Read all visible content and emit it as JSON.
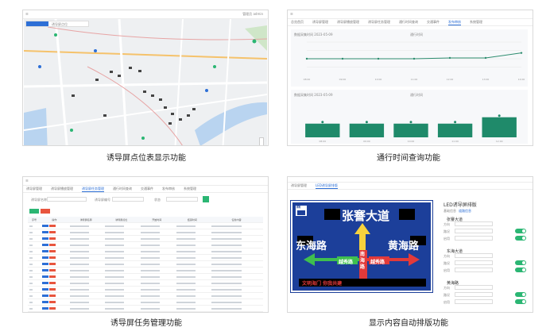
{
  "captions": {
    "map": "诱导屏点位表显示功能",
    "traffic": "通行时间查询功能",
    "tasks": "诱导屏任务管理功能",
    "layout": "显示内容自动排版功能"
  },
  "map_panel": {
    "user_label": "管理员 admin",
    "filter_label": "诱导屏点位",
    "tabs": [
      "全部",
      "在线",
      "离线"
    ]
  },
  "traffic_panel": {
    "tabs": [
      "总览首页",
      "诱导屏管理",
      "诱导屏播放管理",
      "诱导屏任务管理",
      "通行时间查询",
      "交通事件",
      "发布审核",
      "系统管理"
    ],
    "line_chart_title": "数据采集时间 2023-05-09",
    "bar_chart_title": "数据采集时间 2023-05-09",
    "legend": "通行时间"
  },
  "chart_data": [
    {
      "type": "line",
      "title": "",
      "x": [
        "08:00",
        "09:00",
        "10:00",
        "11:00",
        "12:00",
        "13:00",
        "14:00"
      ],
      "series": [
        {
          "values": [
            20,
            20,
            20,
            20,
            21,
            21,
            27
          ]
        }
      ],
      "ylim": [
        0,
        40
      ]
    },
    {
      "type": "bar",
      "title": "",
      "categories": [
        "08:00",
        "09:00",
        "10:00",
        "11:00",
        "12:00"
      ],
      "values": [
        15,
        15,
        15,
        15,
        22
      ],
      "ylim": [
        0,
        40
      ]
    }
  ],
  "tasks_panel": {
    "tabs": [
      "诱导屏管理",
      "诱导屏播放管理",
      "诱导屏任务管理",
      "通行时间查询",
      "交通事件",
      "发布审核",
      "系统管理"
    ],
    "filter_labels": [
      "诱导屏名称",
      "诱导屏编号",
      "状态"
    ],
    "add_button": "新增",
    "delete_button": "删除",
    "headers": [
      "序号",
      "操作",
      "诱导屏名称",
      "诱导屏点位",
      "开始时间",
      "结束时间",
      "任务内容"
    ],
    "row_count": 14
  },
  "layout_panel": {
    "tabs": [
      "诱导屏管理",
      "LED诱导屏排版"
    ],
    "section_title": "LED诱导屏排版",
    "sub_tabs": [
      "基础信息",
      "道路信息"
    ],
    "sign": {
      "top_road": "张謇大道",
      "left_road": "东海路",
      "right_road": "黄海路",
      "center_road": "南海路",
      "inner_left": "越秀路",
      "inner_right": "越秀路",
      "badge": "西",
      "footer": "文明海门 你我共建"
    },
    "groups": [
      {
        "title": "张謇大道",
        "fields": [
          "方向",
          "路况",
          "启用"
        ]
      },
      {
        "title": "东海大道",
        "fields": [
          "方向",
          "路况",
          "启用"
        ]
      },
      {
        "title": "黄海路",
        "fields": [
          "方向",
          "路况",
          "启用"
        ]
      }
    ]
  }
}
